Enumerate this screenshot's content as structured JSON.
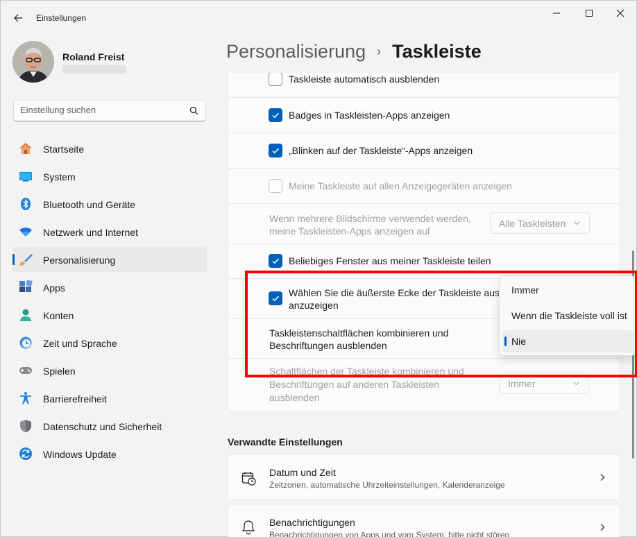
{
  "window": {
    "title": "Einstellungen",
    "accent": "#005fb8"
  },
  "user": {
    "name": "Roland Freist"
  },
  "search": {
    "placeholder": "Einstellung suchen"
  },
  "nav": {
    "items": [
      {
        "label": "Startseite",
        "icon": "home-icon"
      },
      {
        "label": "System",
        "icon": "system-icon"
      },
      {
        "label": "Bluetooth und Geräte",
        "icon": "bluetooth-icon"
      },
      {
        "label": "Netzwerk und Internet",
        "icon": "network-icon"
      },
      {
        "label": "Personalisierung",
        "icon": "brush-icon",
        "active": true
      },
      {
        "label": "Apps",
        "icon": "apps-icon"
      },
      {
        "label": "Konten",
        "icon": "account-icon"
      },
      {
        "label": "Zeit und Sprache",
        "icon": "time-language-icon"
      },
      {
        "label": "Spielen",
        "icon": "gaming-icon"
      },
      {
        "label": "Barrierefreiheit",
        "icon": "accessibility-icon"
      },
      {
        "label": "Datenschutz und Sicherheit",
        "icon": "shield-icon"
      },
      {
        "label": "Windows Update",
        "icon": "update-icon"
      }
    ]
  },
  "breadcrumb": {
    "parent": "Personalisierung",
    "separator": "›",
    "current": "Taskleiste"
  },
  "settings": {
    "auto_hide": {
      "label": "Taskleiste automatisch ausblenden",
      "checked": false
    },
    "badges": {
      "label": "Badges in Taskleisten-Apps anzeigen",
      "checked": true
    },
    "flashing": {
      "label": "„Blinken auf der Taskleiste“-Apps anzeigen",
      "checked": true
    },
    "all_displays": {
      "label": "Meine Taskleiste auf allen Anzeigegeräten anzeigen",
      "checked": false,
      "disabled": true
    },
    "multi_display": {
      "line1": "Wenn mehrere Bildschirme verwendet werden,",
      "line2": "meine Taskleisten-Apps anzeigen auf",
      "value": "Alle Taskleisten"
    },
    "share_window": {
      "label": "Beliebiges Fenster aus meiner Taskleiste teilen",
      "checked": true
    },
    "far_corner": {
      "line1": "Wählen Sie die äußerste Ecke der Taskleiste aus, u",
      "line2": "anzuzeigen",
      "checked": true
    },
    "combine": {
      "line1": "Taskleistenschaltflächen kombinieren und",
      "line2": "Beschriftungen ausblenden"
    },
    "combine_other": {
      "line1": "Schaltflächen der Taskleiste kombinieren und",
      "line2": "Beschriftungen auf anderen Taskleisten",
      "line3": "ausblenden",
      "value": "Immer"
    }
  },
  "dropdown": {
    "options": [
      "Immer",
      "Wenn die Taskleiste voll ist",
      "Nie"
    ],
    "selected": "Nie"
  },
  "related": {
    "title": "Verwandte Einstellungen",
    "items": [
      {
        "title": "Datum und Zeit",
        "subtitle": "Zeitzonen, automatische Uhrzeiteinstellungen, Kalenderanzeige",
        "icon": "calendar-clock-icon"
      },
      {
        "title": "Benachrichtigungen",
        "subtitle": "Benachrichtigungen von Apps und vom System, bitte nicht stören",
        "icon": "bell-icon"
      }
    ]
  },
  "annotation": {
    "highlight_color": "#ff0000"
  }
}
